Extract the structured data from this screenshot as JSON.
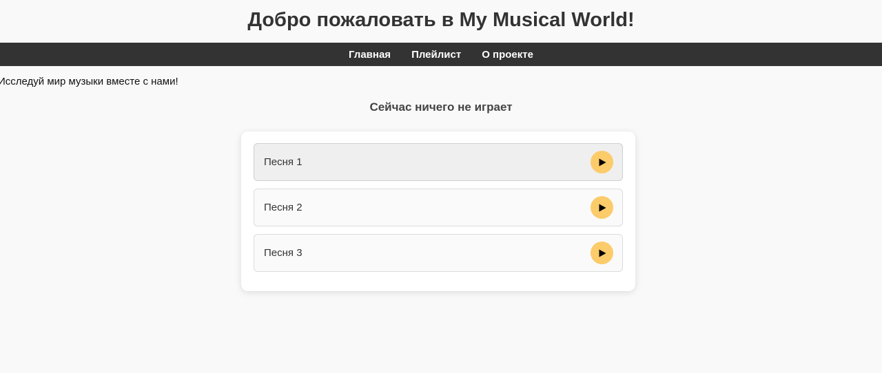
{
  "header": {
    "title": "Добро пожаловать в My Musical World!"
  },
  "nav": {
    "items": [
      {
        "label": "Главная"
      },
      {
        "label": "Плейлист"
      },
      {
        "label": "О проекте"
      }
    ]
  },
  "intro": {
    "text": "Исследуй мир музыки вместе с нами!"
  },
  "player": {
    "now_playing": "Сейчас ничего не играет"
  },
  "playlist": {
    "songs": [
      {
        "title": "Песня 1",
        "active": true
      },
      {
        "title": "Песня 2",
        "active": false
      },
      {
        "title": "Песня 3",
        "active": false
      }
    ],
    "play_icon": "play-icon"
  },
  "colors": {
    "navbar_bg": "#333333",
    "play_button": "#fccb6a",
    "page_bg": "#f9f9f9"
  }
}
